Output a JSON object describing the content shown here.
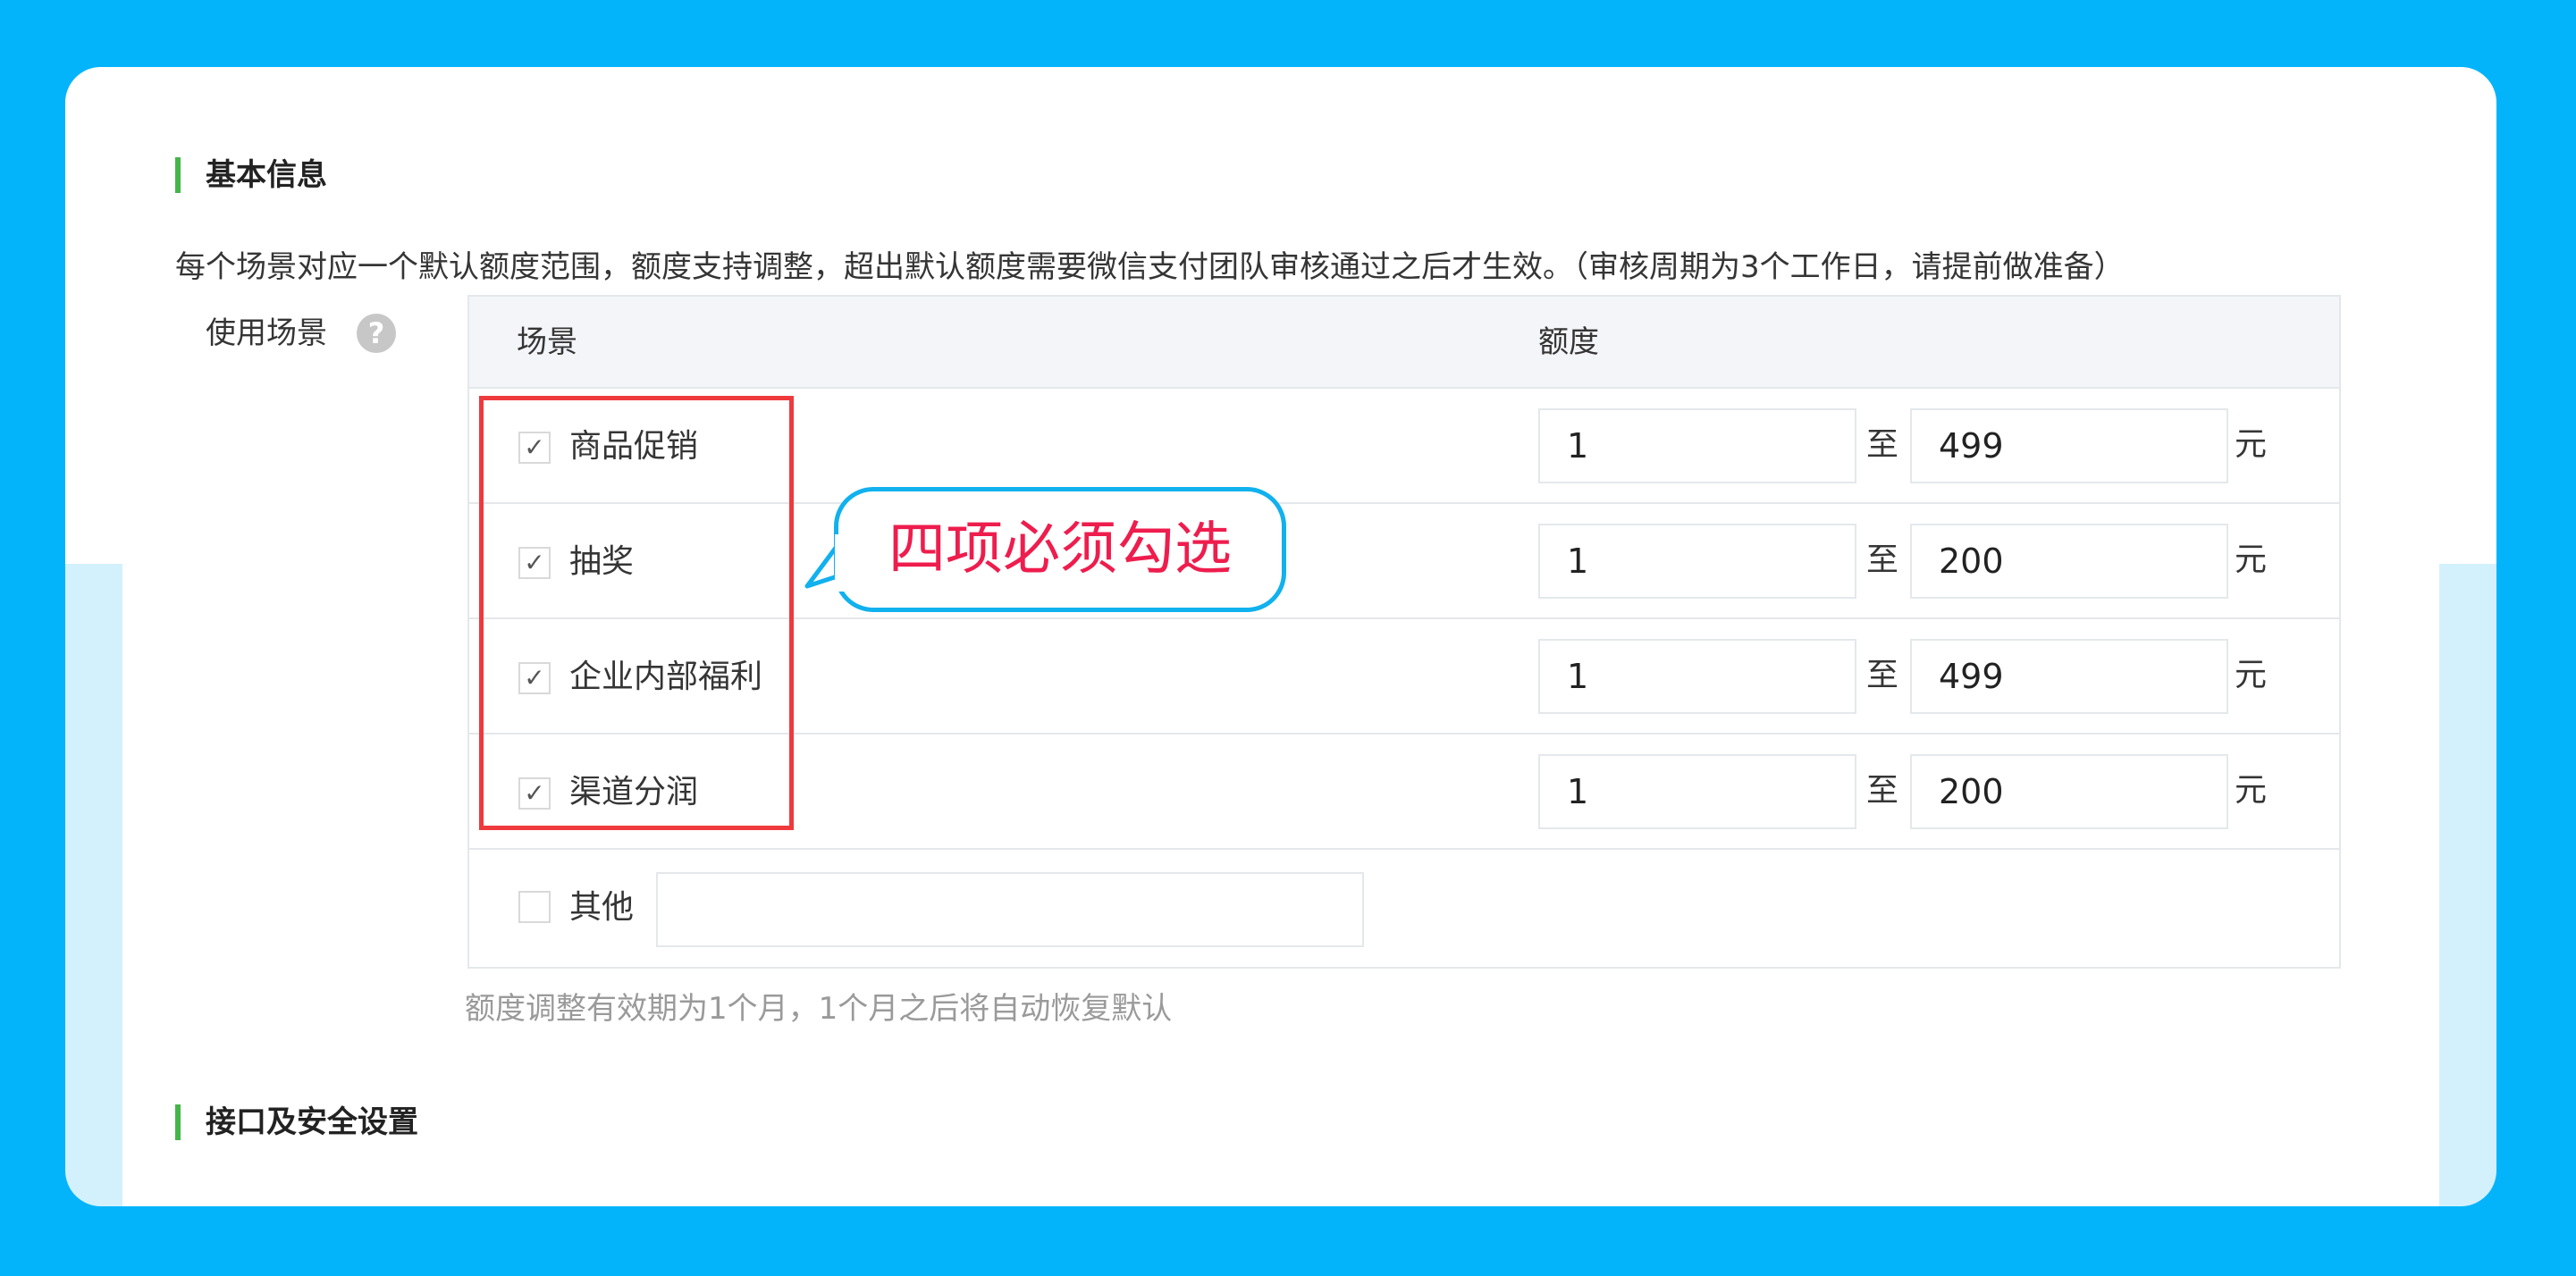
{
  "sections": {
    "basic_title": "基本信息",
    "api_title": "接口及安全设置"
  },
  "description": "每个场景对应一个默认额度范围，额度支持调整，超出默认额度需要微信支付团队审核通过之后才生效。（审核周期为3个工作日，请提前做准备）",
  "field_label": "使用场景",
  "help_glyph": "?",
  "table": {
    "header_scene": "场景",
    "header_quota": "额度",
    "separator": "至",
    "unit": "元",
    "rows": [
      {
        "label": "商品促销",
        "checked": true,
        "min": "1",
        "max": "499"
      },
      {
        "label": "抽奖",
        "checked": true,
        "min": "1",
        "max": "200"
      },
      {
        "label": "企业内部福利",
        "checked": true,
        "min": "1",
        "max": "499"
      },
      {
        "label": "渠道分润",
        "checked": true,
        "min": "1",
        "max": "200"
      }
    ],
    "other": {
      "label": "其他",
      "checked": false,
      "value": ""
    }
  },
  "hint": "额度调整有效期为1个月，1个月之后将自动恢复默认",
  "callout": "四项必须勾选",
  "colors": {
    "background": "#03b4fb",
    "accent_green": "#44b549",
    "highlight_red": "#ef3a3d",
    "callout_border": "#11b1ee",
    "callout_text": "#ee1d4d"
  }
}
